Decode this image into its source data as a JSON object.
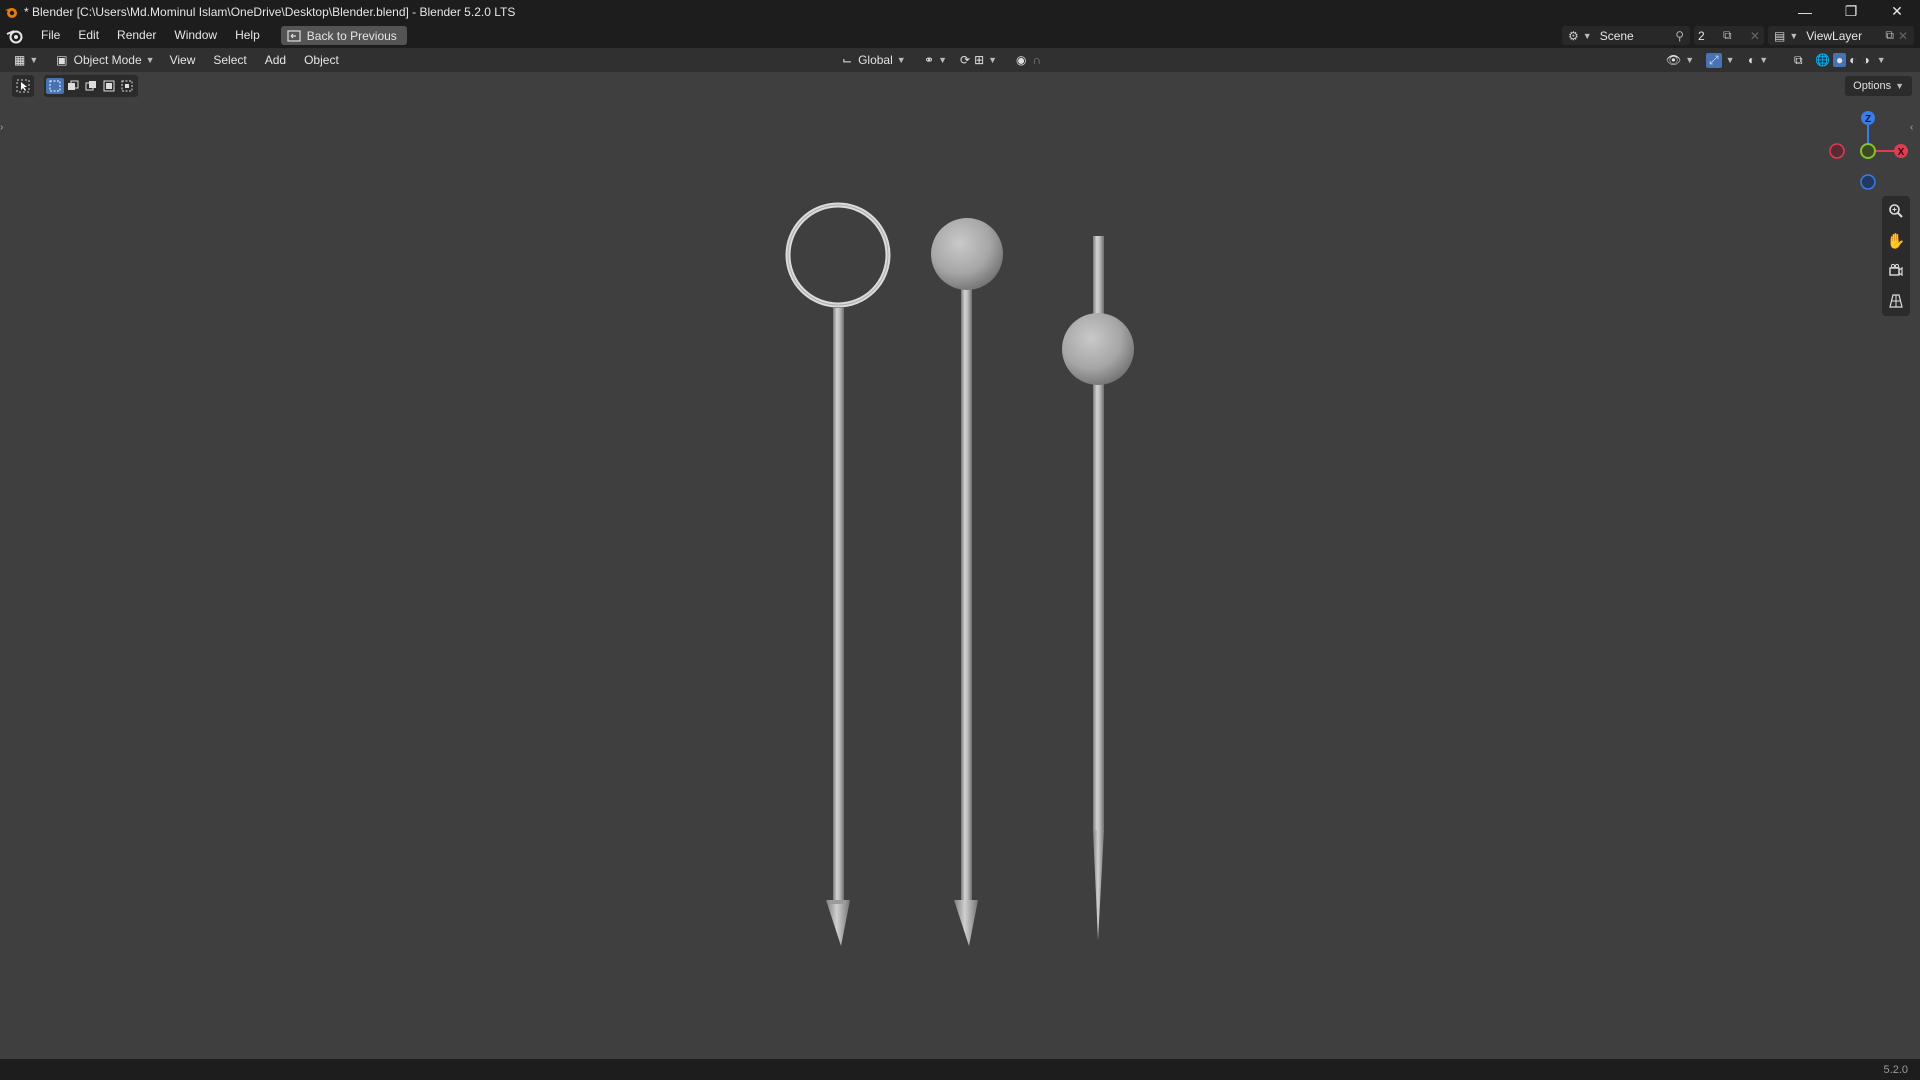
{
  "window": {
    "title": "* Blender [C:\\Users\\Md.Mominul Islam\\OneDrive\\Desktop\\Blender.blend] - Blender 5.2.0 LTS",
    "controls": [
      "minimize-icon",
      "restore-icon",
      "close-icon"
    ]
  },
  "menu": {
    "items": [
      "File",
      "Edit",
      "Render",
      "Window",
      "Help"
    ],
    "back_button": "Back to Previous"
  },
  "scene": {
    "name": "Scene",
    "users": "2",
    "view_layer": "ViewLayer"
  },
  "viewport_header": {
    "mode": "Object Mode",
    "menus": [
      "View",
      "Select",
      "Add",
      "Object"
    ],
    "transform_orientation": "Global"
  },
  "tools": {
    "options_label": "Options"
  },
  "gizmo": {
    "z_label": "Z",
    "x_label": "X",
    "colors": {
      "x": "#e03c50",
      "y": "#86c32a",
      "z": "#3a7ce8"
    }
  },
  "status": {
    "version": "5.2.0"
  },
  "objects": [
    "ring-pin",
    "ball-pin",
    "bead-pin"
  ]
}
